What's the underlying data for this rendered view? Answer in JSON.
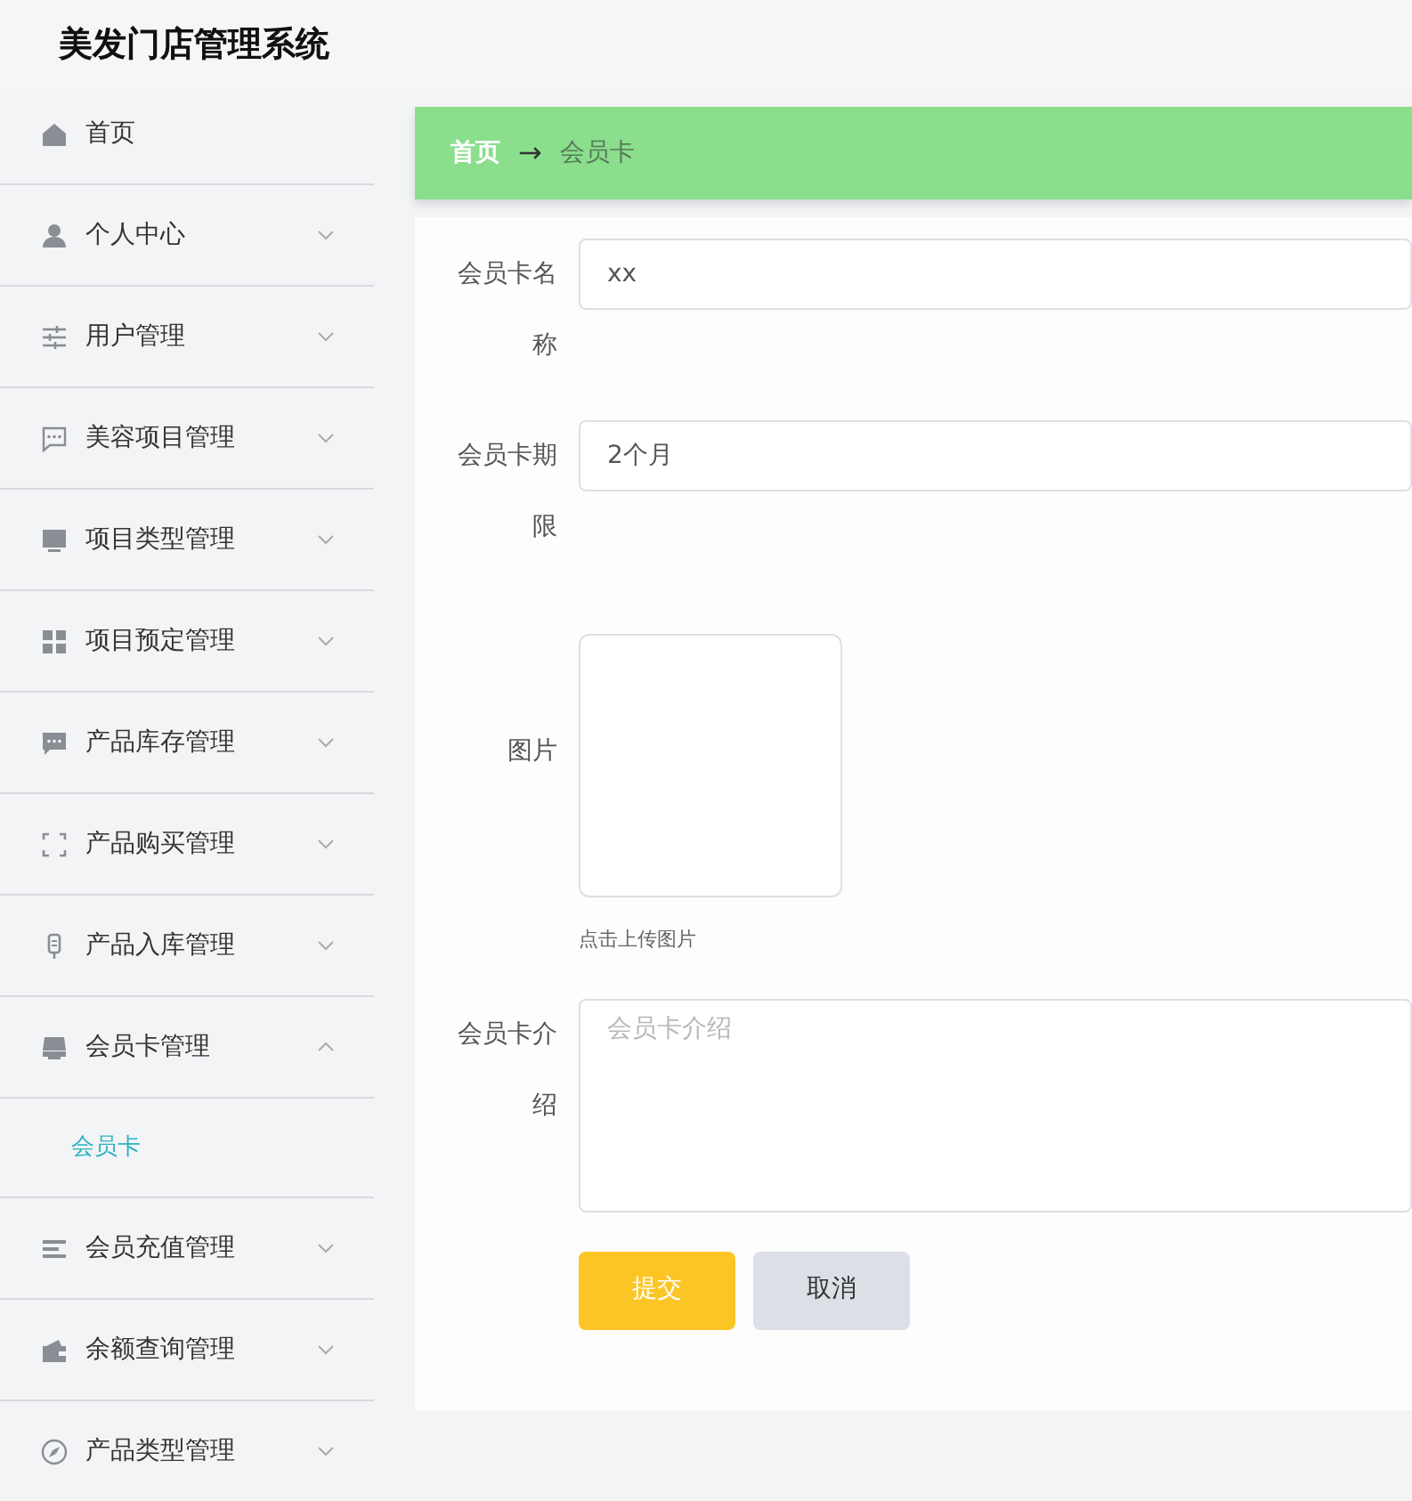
{
  "app_title": "美发门店管理系统",
  "sidebar": {
    "items": [
      {
        "label": "首页",
        "kind": "link"
      },
      {
        "label": "个人中心",
        "kind": "menu",
        "expanded": false
      },
      {
        "label": "用户管理",
        "kind": "menu",
        "expanded": false
      },
      {
        "label": "美容项目管理",
        "kind": "menu",
        "expanded": false
      },
      {
        "label": "项目类型管理",
        "kind": "menu",
        "expanded": false
      },
      {
        "label": "项目预定管理",
        "kind": "menu",
        "expanded": false
      },
      {
        "label": "产品库存管理",
        "kind": "menu",
        "expanded": false
      },
      {
        "label": "产品购买管理",
        "kind": "menu",
        "expanded": false
      },
      {
        "label": "产品入库管理",
        "kind": "menu",
        "expanded": false
      },
      {
        "label": "会员卡管理",
        "kind": "menu",
        "expanded": true,
        "children": [
          {
            "label": "会员卡",
            "selected": true
          }
        ]
      },
      {
        "label": "会员充值管理",
        "kind": "menu",
        "expanded": false
      },
      {
        "label": "余额查询管理",
        "kind": "menu",
        "expanded": false
      },
      {
        "label": "产品类型管理",
        "kind": "menu",
        "expanded": false
      }
    ]
  },
  "breadcrumb": [
    {
      "label": "首页",
      "current": false
    },
    {
      "label": "会员卡",
      "current": true
    }
  ],
  "breadcrumb_separator": "→",
  "form": {
    "fields": [
      {
        "kind": "text",
        "label": "会员卡名称",
        "value": "xx"
      },
      {
        "kind": "text",
        "label": "会员卡期限",
        "value": "2个月"
      },
      {
        "kind": "upload",
        "label": "图片",
        "hint": "点击上传图片"
      },
      {
        "kind": "textarea",
        "label": "会员卡介绍",
        "placeholder": "会员卡介绍"
      }
    ],
    "buttons": [
      {
        "kind": "primary",
        "label": "提交"
      },
      {
        "kind": "secondary",
        "label": "取消"
      }
    ]
  }
}
